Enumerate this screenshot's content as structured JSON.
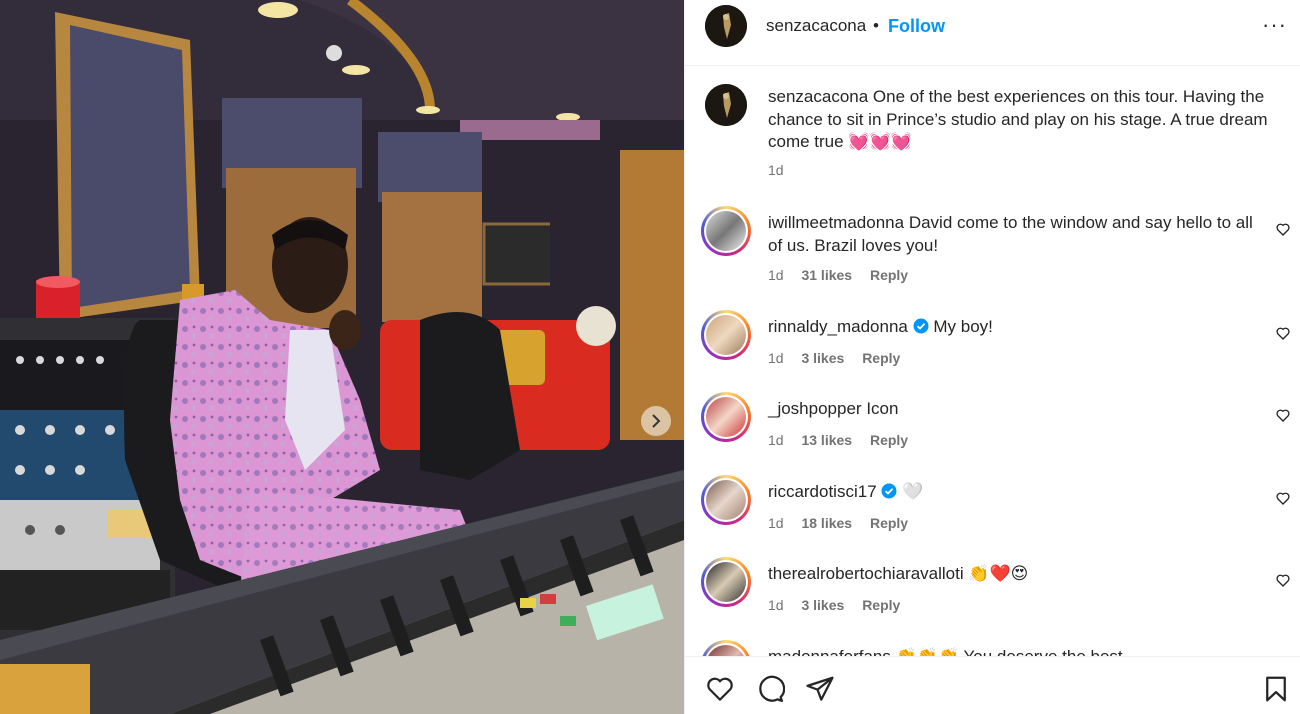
{
  "post": {
    "username": "senzacacona",
    "separator": "•",
    "follow_label": "Follow",
    "more_label": "···",
    "caption_text": "One of the best experiences on this tour. Having the chance to sit in Prince’s studio and play on his stage. A true dream come true 💓💓💓",
    "caption_time": "1d"
  },
  "comments": [
    {
      "username": "iwillmeetmadonna",
      "text": "David come to the window and say hello to all of us. Brazil loves you!",
      "time": "1d",
      "likes": "31 likes",
      "reply": "Reply",
      "verified": false
    },
    {
      "username": "rinnaldy_madonna",
      "text": "My boy!",
      "time": "1d",
      "likes": "3 likes",
      "reply": "Reply",
      "verified": true
    },
    {
      "username": "_joshpopper",
      "text": "Icon",
      "time": "1d",
      "likes": "13 likes",
      "reply": "Reply",
      "verified": false
    },
    {
      "username": "riccardotisci17",
      "text": "🤍",
      "time": "1d",
      "likes": "18 likes",
      "reply": "Reply",
      "verified": true
    },
    {
      "username": "therealrobertochiaravalloti",
      "text": "👏❤️😍",
      "time": "1d",
      "likes": "3 likes",
      "reply": "Reply",
      "verified": false
    },
    {
      "username": "madonnaforfans",
      "text": "👏👏👏 You deserve the best",
      "time": "",
      "likes": "",
      "reply": "",
      "verified": false
    }
  ],
  "icons": {
    "like": "heart-icon",
    "comment": "comment-icon",
    "share": "share-icon",
    "save": "bookmark-icon",
    "next": "chevron-right-icon"
  },
  "colors": {
    "accent": "#0095f6",
    "verified": "#0095f6"
  }
}
